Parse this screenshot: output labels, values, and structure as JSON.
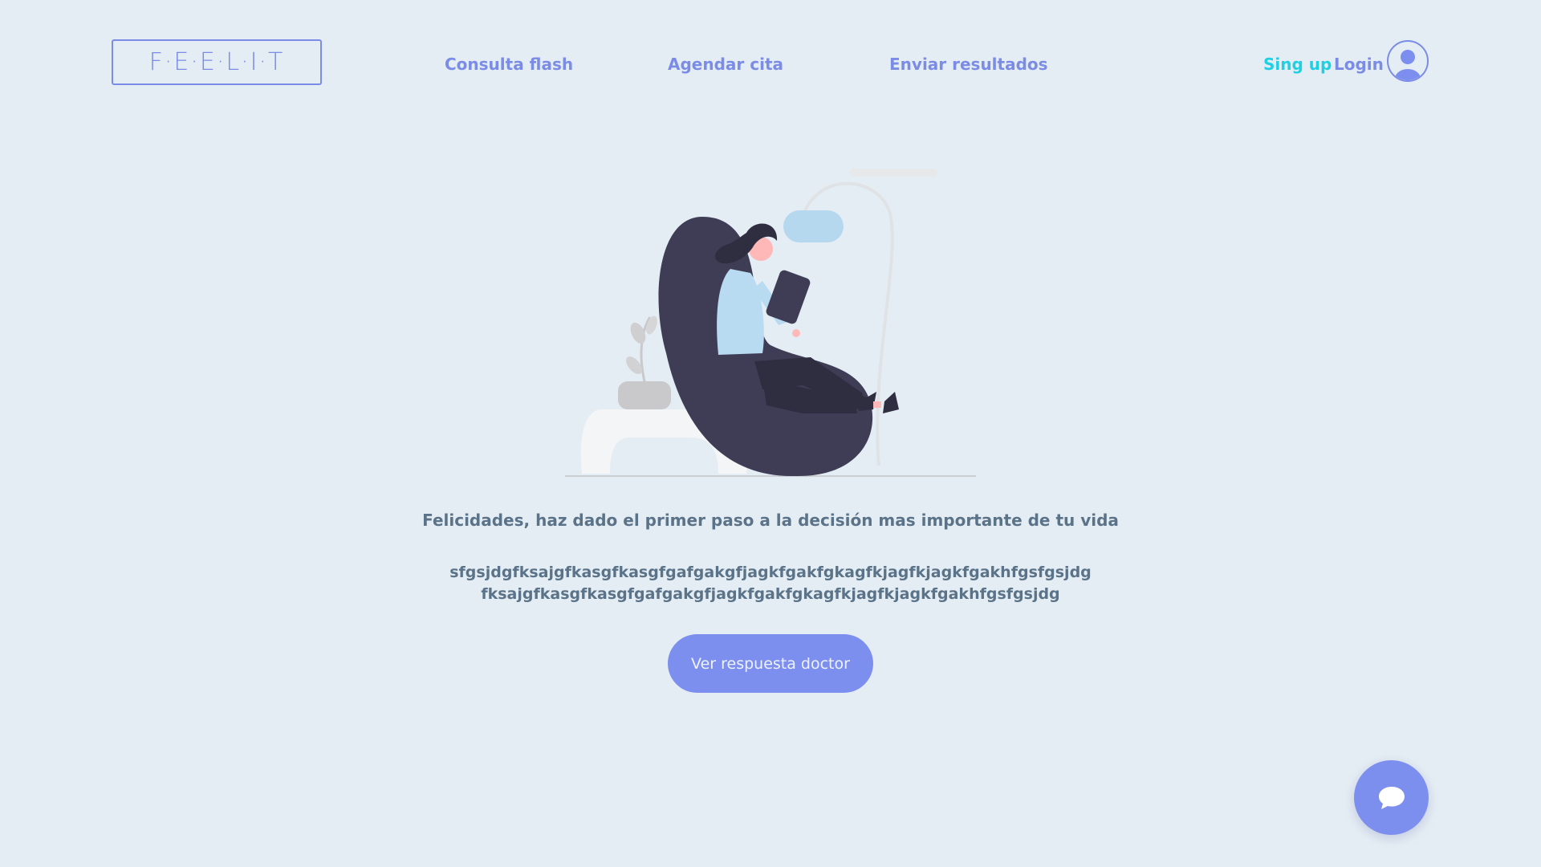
{
  "header": {
    "logo_text": "F·E·E·L·I·T",
    "nav": [
      {
        "label": "Consulta flash"
      },
      {
        "label": "Agendar cita"
      },
      {
        "label": "Enviar resultados"
      }
    ],
    "signup_label": "Sing up",
    "login_label": "Login",
    "avatar_icon": "user-circle-icon"
  },
  "main": {
    "illustration_icon": "woman-reading-on-beanbag-illustration",
    "heading": "Felicidades, haz dado el primer paso a la decisión mas importante de tu vida",
    "body": "sfgsjdgfksajgfkasgfkasgfgafgakgfjagkfgakfgkagfkjagfkjagkfgakhfgsfgsjdgfksajgfkasgfkasgfgafgakgfjagkfgakfgkagfkjagfkjagkfgakhfgsfgsjdg",
    "cta_label": "Ver respuesta doctor"
  },
  "chat_button": {
    "icon": "chat-bubble-icon"
  },
  "colors": {
    "background": "#e5edf4",
    "accent": "#7d8fee",
    "signup": "#1fd0e3",
    "text": "#5b7388"
  }
}
